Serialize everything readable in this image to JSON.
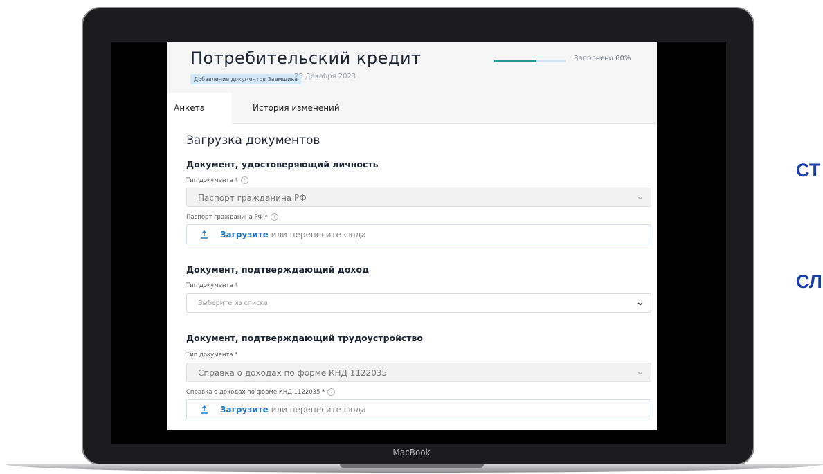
{
  "device": {
    "label": "MacBook"
  },
  "header": {
    "title": "Потребительский кредит",
    "badge": "Добавление документов Заемщика",
    "date": "25 Декабря 2023",
    "progress_fraction": 0.6,
    "progress_label": "Заполнено 60%"
  },
  "tabs": [
    {
      "label": "Анкета",
      "active": true
    },
    {
      "label": "История изменений",
      "active": false
    }
  ],
  "form": {
    "title": "Загрузка документов",
    "identity": {
      "title": "Документ, удостоверяющий личность",
      "type_label": "Тип документа *",
      "type_value": "Паспорт гражданина РФ",
      "file_label": "Паспорт гражданина РФ *",
      "upload_link": "Загрузите",
      "upload_rest": " или перенесите сюда"
    },
    "income": {
      "title": "Документ, подтверждающий доход",
      "type_label": "Тип документа *",
      "type_placeholder": "Выберите из списка"
    },
    "employment": {
      "title": "Документ, подтверждающий трудоустройство",
      "type_label": "Тип документа *",
      "type_value": "Справка о доходах по форме КНД 1122035",
      "file_label": "Справка о доходах по форме КНД 1122035 *",
      "upload_link": "Загрузите",
      "upload_rest": " или перенесите сюда"
    }
  },
  "side_text": [
    "СТ",
    "СЛ"
  ],
  "colors": {
    "accent": "#1e78c2",
    "progress": "#1f9a8a",
    "badge_bg": "#d3e9f8",
    "side_text": "#1a3ea8"
  },
  "icons": {
    "help": "?",
    "upload": "upload-icon",
    "chevron": "chevron-down-icon"
  }
}
